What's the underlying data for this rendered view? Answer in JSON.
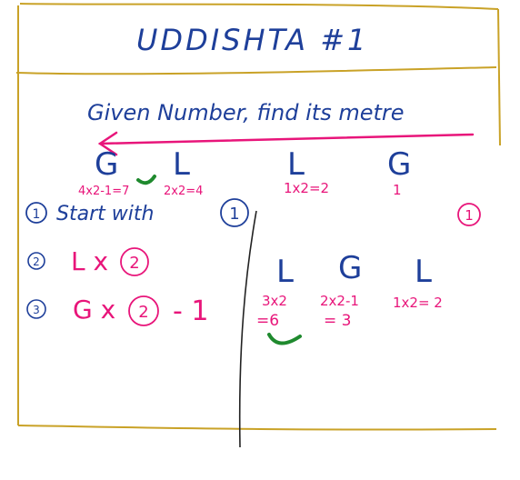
{
  "heading": "UDDISHTA #1",
  "subtitle": "Given Number, find its metre",
  "top_row": [
    {
      "symbol": "G",
      "calc": "4x2-1=7"
    },
    {
      "symbol": "L",
      "calc": "2x2=4"
    },
    {
      "symbol": "L",
      "calc": "1x2=2"
    },
    {
      "symbol": "G",
      "calc": "1"
    }
  ],
  "steps": [
    {
      "num": "1",
      "text": "Start with",
      "circled": "1"
    },
    {
      "num": "2",
      "text": "L x",
      "circled": "2",
      "tail": ""
    },
    {
      "num": "3",
      "text": "G x",
      "circled": "2",
      "tail": "- 1"
    }
  ],
  "example_marker": "1",
  "example_row": [
    {
      "symbol": "L",
      "calc": "3x2",
      "result": "=6"
    },
    {
      "symbol": "G",
      "calc": "2x2-1",
      "result": "= 3"
    },
    {
      "symbol": "L",
      "calc": "1x2= 2",
      "result": ""
    }
  ],
  "colors": {
    "ink_blue": "#1e3f9a",
    "ink_magenta": "#e8157a",
    "frame_gold": "#c9a227",
    "tick_green": "#1f8a2e"
  }
}
